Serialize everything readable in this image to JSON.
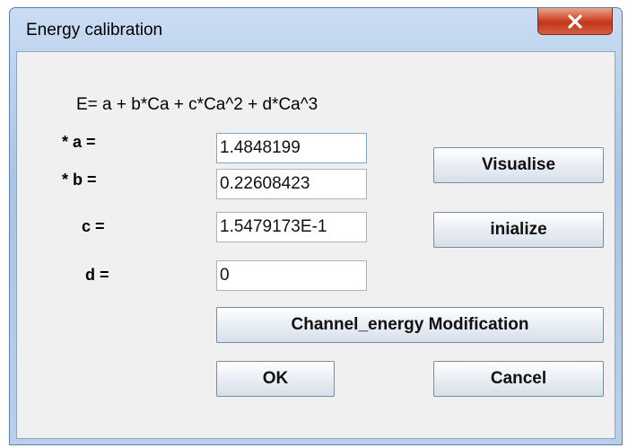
{
  "window": {
    "title": "Energy calibration"
  },
  "formula": "E=  a + b*Ca + c*Ca^2 + d*Ca^3",
  "coefficients": [
    {
      "label": "* a =",
      "value": "1.4848199"
    },
    {
      "label": "* b =",
      "value": "0.22608423"
    },
    {
      "label": "c =",
      "value": "1.5479173E-1"
    },
    {
      "label": "d =",
      "value": "0"
    }
  ],
  "buttons": {
    "visualise": "Visualise",
    "initialize": "inialize",
    "channel_energy": "Channel_energy Modification",
    "ok": "OK",
    "cancel": "Cancel"
  },
  "colors": {
    "close_button": "#c7422a",
    "client_bg": "#f0f0f0",
    "frame": "#a9c4e6"
  },
  "icons": {
    "close": "close-x-icon"
  }
}
